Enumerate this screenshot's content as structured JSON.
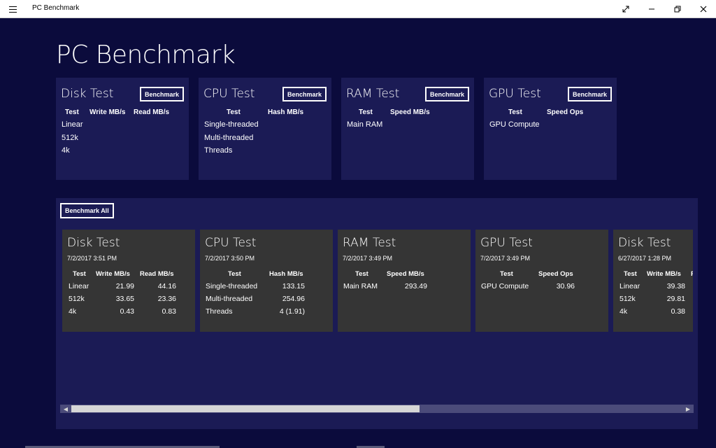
{
  "window": {
    "title": "PC Benchmark",
    "controls": [
      "fullscreen",
      "minimize",
      "restore",
      "close"
    ]
  },
  "page": {
    "title": "PC Benchmark"
  },
  "benchmark_label": "Benchmark",
  "test_cards": {
    "disk": {
      "title": "Disk Test",
      "headers": [
        "Test",
        "Write MB/s",
        "Read MB/s"
      ],
      "rows": [
        "Linear",
        "512k",
        "4k"
      ]
    },
    "cpu": {
      "title": "CPU Test",
      "headers": [
        "Test",
        "Hash MB/s"
      ],
      "rows": [
        "Single-threaded",
        "Multi-threaded",
        "Threads"
      ]
    },
    "ram": {
      "title": "RAM Test",
      "headers": [
        "Test",
        "Speed MB/s"
      ],
      "rows": [
        "Main RAM"
      ]
    },
    "gpu": {
      "title": "GPU Test",
      "headers": [
        "Test",
        "Speed Ops"
      ],
      "rows": [
        "GPU Compute"
      ]
    }
  },
  "results": {
    "benchmark_all_label": "Benchmark All",
    "cards": {
      "disk": {
        "title": "Disk Test",
        "date": "7/2/2017 3:51 PM",
        "headers": [
          "Test",
          "Write MB/s",
          "Read MB/s"
        ],
        "rows": [
          [
            "Linear",
            "21.99",
            "44.16"
          ],
          [
            "512k",
            "33.65",
            "23.36"
          ],
          [
            "4k",
            "0.43",
            "0.83"
          ]
        ]
      },
      "cpu": {
        "title": "CPU Test",
        "date": "7/2/2017 3:50 PM",
        "headers": [
          "Test",
          "Hash MB/s"
        ],
        "rows": [
          [
            "Single-threaded",
            "133.15"
          ],
          [
            "Multi-threaded",
            "254.96"
          ],
          [
            "Threads",
            "4 (1.91)"
          ]
        ]
      },
      "ram": {
        "title": "RAM Test",
        "date": "7/2/2017 3:49 PM",
        "headers": [
          "Test",
          "Speed MB/s"
        ],
        "rows": [
          [
            "Main RAM",
            "293.49"
          ]
        ]
      },
      "gpu": {
        "title": "GPU Test",
        "date": "7/2/2017 3:49 PM",
        "headers": [
          "Test",
          "Speed Ops"
        ],
        "rows": [
          [
            "GPU Compute",
            "30.96"
          ]
        ]
      },
      "disk2": {
        "title": "Disk Test",
        "date": "6/27/2017 1:28 PM",
        "headers": [
          "Test",
          "Write MB/s",
          "R"
        ],
        "rows": [
          [
            "Linear",
            "39.38"
          ],
          [
            "512k",
            "29.81"
          ],
          [
            "4k",
            "0.38"
          ]
        ]
      }
    },
    "scroll_position": 0.55
  },
  "colors": {
    "background": "#0b0b3c",
    "card": "#1b1b55",
    "result_card": "#353535",
    "text": "#ffffff"
  }
}
